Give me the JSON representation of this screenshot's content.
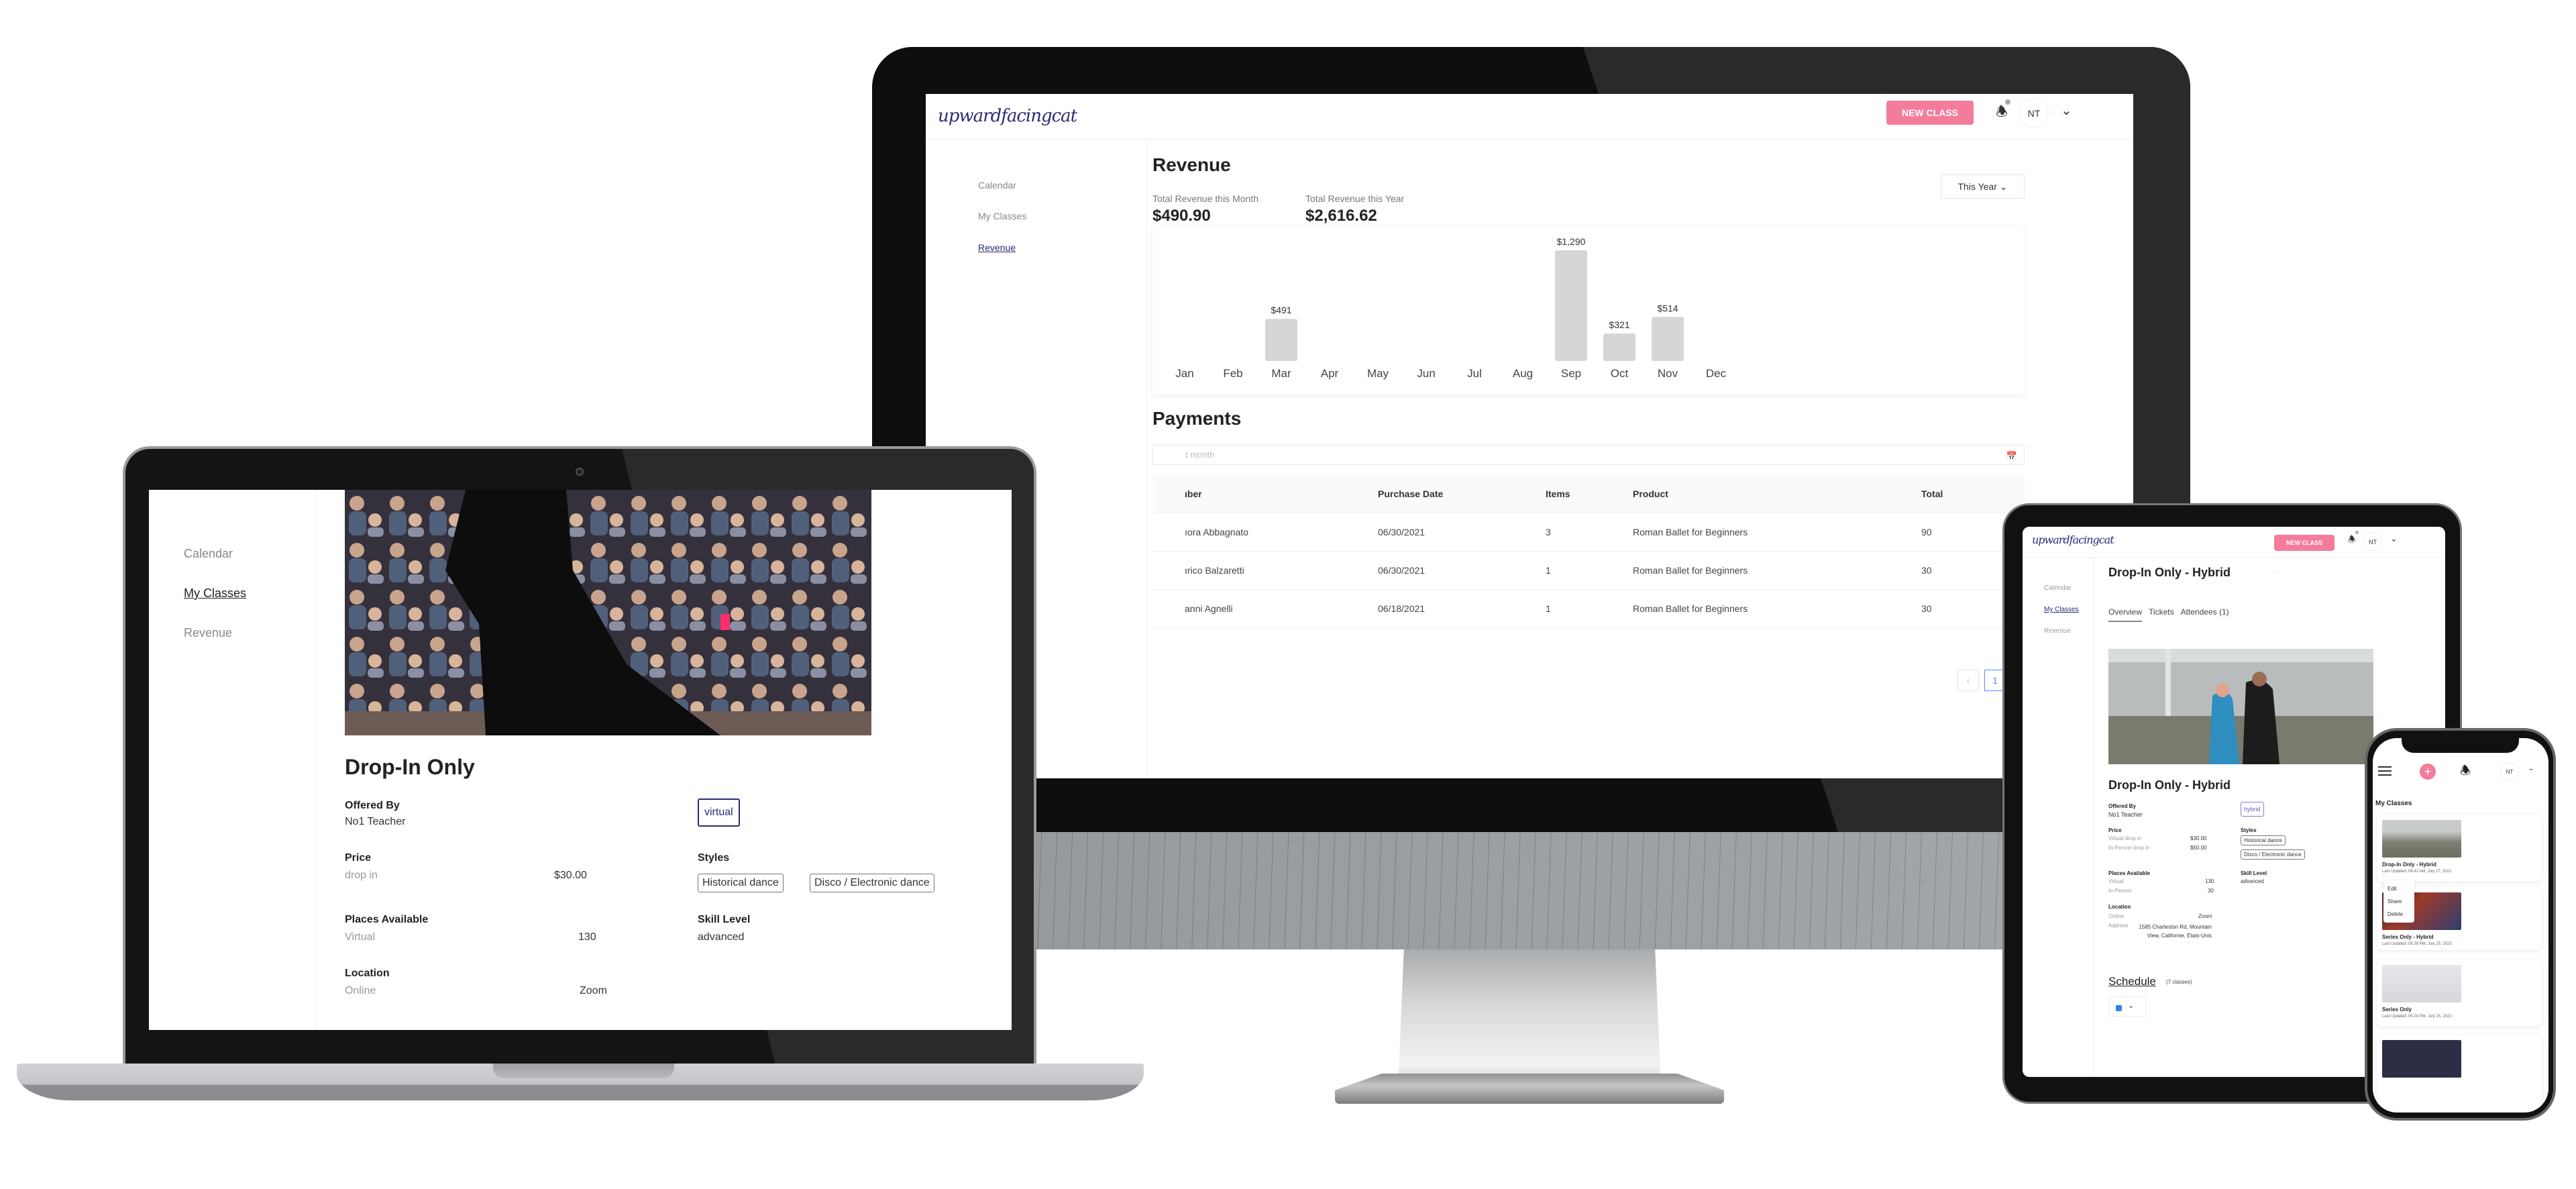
{
  "brand": {
    "logo_text": "upwardfacingcat",
    "accent_pink": "#f47c9b",
    "accent_navy": "#2b2a78",
    "link_blue": "#4b8ef7"
  },
  "header": {
    "new_class_label": "NEW CLASS",
    "avatar_initials": "NT",
    "bell_icon": "bell-icon",
    "caret_icon": "chevron-down-icon"
  },
  "sidebar": {
    "items": [
      {
        "label": "Calendar"
      },
      {
        "label": "My Classes"
      },
      {
        "label": "Revenue"
      }
    ]
  },
  "monitor": {
    "active_nav": "Revenue",
    "revenue": {
      "title": "Revenue",
      "month_label": "Total Revenue this Month",
      "month_value": "$490.90",
      "year_label": "Total Revenue this Year",
      "year_value": "$2,616.62",
      "period_select": "This Year"
    },
    "payments": {
      "title": "Payments",
      "date_filter_placeholder": "t month",
      "columns": [
        "ıber",
        "Purchase Date",
        "Items",
        "Product",
        "Total"
      ],
      "rows": [
        [
          "ıora Abbagnato",
          "06/30/2021",
          "3",
          "Roman Ballet for Beginners",
          "90"
        ],
        [
          "ırico Balzaretti",
          "06/30/2021",
          "1",
          "Roman Ballet for Beginners",
          "30"
        ],
        [
          "anni Agnelli",
          "06/18/2021",
          "1",
          "Roman Ballet for Beginners",
          "30"
        ]
      ],
      "pagination": {
        "prev": "‹",
        "current": "1",
        "next": "›"
      }
    }
  },
  "chart_data": {
    "type": "bar",
    "title": "Revenue",
    "xlabel": "",
    "ylabel": "",
    "categories": [
      "Jan",
      "Feb",
      "Mar",
      "Apr",
      "May",
      "Jun",
      "Jul",
      "Aug",
      "Sep",
      "Oct",
      "Nov",
      "Dec"
    ],
    "values": [
      0,
      0,
      491,
      0,
      0,
      0,
      0,
      0,
      1290,
      321,
      514,
      0
    ],
    "data_labels": [
      "",
      "",
      "$491",
      "",
      "",
      "",
      "",
      "",
      "$1,290",
      "$321",
      "$514",
      ""
    ],
    "ylim": [
      0,
      1290
    ],
    "grid": false,
    "legend": "none",
    "bar_color": "#d6d6d6"
  },
  "laptop": {
    "active_nav": "My Classes",
    "class": {
      "title": "Drop-In Only",
      "offered_by_label": "Offered By",
      "offered_by": "No1 Teacher",
      "mode_tag": "virtual",
      "price_label": "Price",
      "price_rows": [
        {
          "name": "drop in",
          "value": "$30.00"
        }
      ],
      "styles_label": "Styles",
      "styles": [
        "Historical dance",
        "Disco / Electronic dance"
      ],
      "places_label": "Places Available",
      "places_rows": [
        {
          "name": "Virtual",
          "value": "130"
        }
      ],
      "skill_label": "Skill Level",
      "skill": "advanced",
      "location_label": "Location",
      "location_rows": [
        {
          "name": "Online",
          "value": "Zoom"
        }
      ]
    }
  },
  "tablet": {
    "active_nav": "My Classes",
    "page_title": "Drop-In Only - Hybrid",
    "more_icon": "ellipsis-icon",
    "tabs": [
      {
        "label": "Overview",
        "active": true
      },
      {
        "label": "Tickets",
        "active": false
      },
      {
        "label": "Attendees (1)",
        "active": false
      }
    ],
    "class": {
      "title": "Drop-In Only - Hybrid",
      "offered_by_label": "Offered By",
      "offered_by": "No1 Teacher",
      "mode_tag": "hybrid",
      "price_label": "Price",
      "price_rows": [
        {
          "name": "Virtual drop in",
          "value": "$30.00"
        },
        {
          "name": "In-Person drop in",
          "value": "$50.00"
        }
      ],
      "styles_label": "Styles",
      "styles": [
        "Historical dance",
        "Disco / Electronic dance"
      ],
      "places_label": "Places Available",
      "places_rows": [
        {
          "name": "Virtual",
          "value": "130"
        },
        {
          "name": "In-Person",
          "value": "30"
        }
      ],
      "skill_label": "Skill Level",
      "skill": "advanced",
      "location_label": "Location",
      "location_rows": [
        {
          "name": "Online",
          "value": "Zoom"
        },
        {
          "name": "Address",
          "value": "1585 Charleston Rd, Mountain View, Californie, États-Unis"
        }
      ],
      "schedule_label": "Schedule",
      "schedule_count": "(7 classes)"
    }
  },
  "phone": {
    "section_title": "My Classes",
    "menu_icon": "hamburger-icon",
    "add_icon": "plus-icon",
    "classes": [
      {
        "title": "Drop-In Only - Hybrid",
        "updated": "Last Updated: 06:42 AM, July 27, 2022"
      },
      {
        "title": "Series Only - Hybrid",
        "updated": "Last Updated: 05:39 PM, July 25, 2022"
      },
      {
        "title": "Series Only",
        "updated": "Last Updated: 05:24 PM, July 25, 2022"
      }
    ],
    "context_menu": [
      "Edit",
      "Share",
      "Delete"
    ]
  }
}
